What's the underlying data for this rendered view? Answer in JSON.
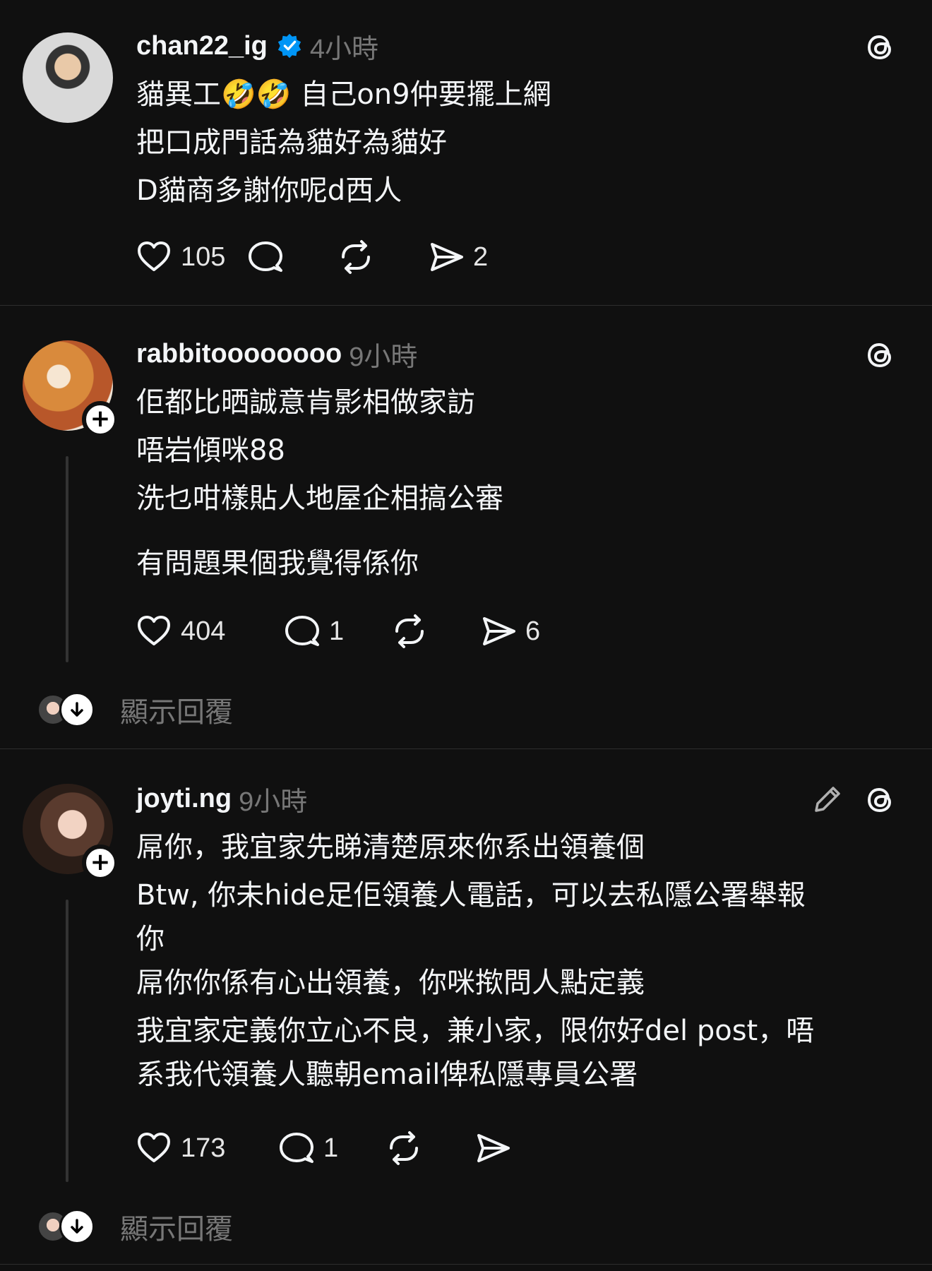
{
  "posts": [
    {
      "username": "chan22_ig",
      "verified": true,
      "time": "4小時",
      "lines": [
        "貓異工🤣🤣 自己on9仲要擺上網",
        "把口成門話為貓好為貓好",
        "D貓商多謝你呢d西人"
      ],
      "likes": "105",
      "replies": "",
      "reposts": "",
      "shares": "2"
    },
    {
      "username": "rabbitoooooooo",
      "verified": false,
      "time": "9小時",
      "lines": [
        "佢都比晒誠意肯影相做家訪",
        "唔岩傾咪88",
        "洗乜咁樣貼人地屋企相搞公審"
      ],
      "extra_line": "有問題果個我覺得係你",
      "likes": "404",
      "replies": "1",
      "reposts": "",
      "shares": "6",
      "show_replies": "顯示回覆"
    },
    {
      "username": "joyti.ng",
      "verified": false,
      "time": "9小時",
      "lines": [
        "屌你，我宜家先睇清楚原來你系出領養個",
        "Btw, 你未hide足佢領養人電話，可以去私隱公署舉報",
        "你",
        "屌你你係有心出領養，你咪揿問人點定義",
        "我宜家定義你立心不良，兼小家，限你好del post，唔",
        "系我代領養人聽朝email俾私隱專員公署"
      ],
      "likes": "173",
      "replies": "1",
      "reposts": "",
      "shares": "",
      "show_replies": "顯示回覆"
    }
  ],
  "colors": {
    "background": "#101010",
    "text": "#f3f5f7",
    "muted": "#777777",
    "verified": "#0095f6"
  }
}
